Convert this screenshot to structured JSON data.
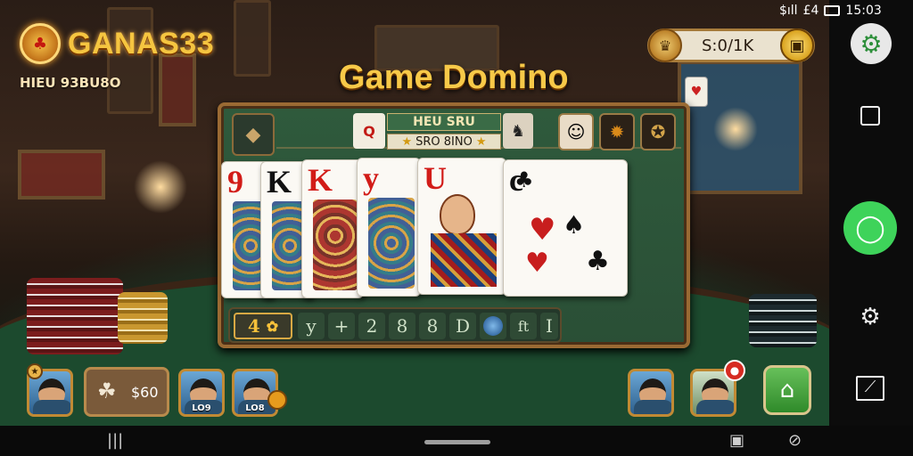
{
  "app": {
    "brand_name": "GANAS33",
    "brand_sub": "HIEU 93BU8O",
    "game_title": "Game Domino"
  },
  "balance": {
    "value": "S:0/1K"
  },
  "board": {
    "header_top": "HEU SRU",
    "header_bottom": "SRO 8INO",
    "left_chip": "Q",
    "cards": [
      {
        "rank": "9",
        "color": "#d21c18"
      },
      {
        "rank": "K",
        "color": "#111111"
      },
      {
        "rank": "K",
        "color": "#d21c18"
      },
      {
        "rank": "y",
        "color": "#d21c18"
      },
      {
        "rank": "U",
        "color": "#d21c18"
      },
      {
        "rank": "c",
        "color": "#111111"
      }
    ],
    "tiles": [
      "4",
      "y",
      "+",
      "2",
      "8",
      "8",
      "D",
      "",
      "ft",
      "I"
    ]
  },
  "players": {
    "left1_label": "",
    "pot_value": "$60",
    "left2_label": "LO9",
    "left3_label": "LO8",
    "right1_label": "",
    "right2_label": ""
  },
  "status_bar": {
    "time": "15:03",
    "signal": "$ıll",
    "net": "£4"
  },
  "icons": {
    "settings": "gear-icon",
    "square": "square-icon",
    "chat": "chat-icon",
    "gear2": "gear-outline-icon",
    "edit": "edit-icon",
    "camera": "camera-icon"
  }
}
